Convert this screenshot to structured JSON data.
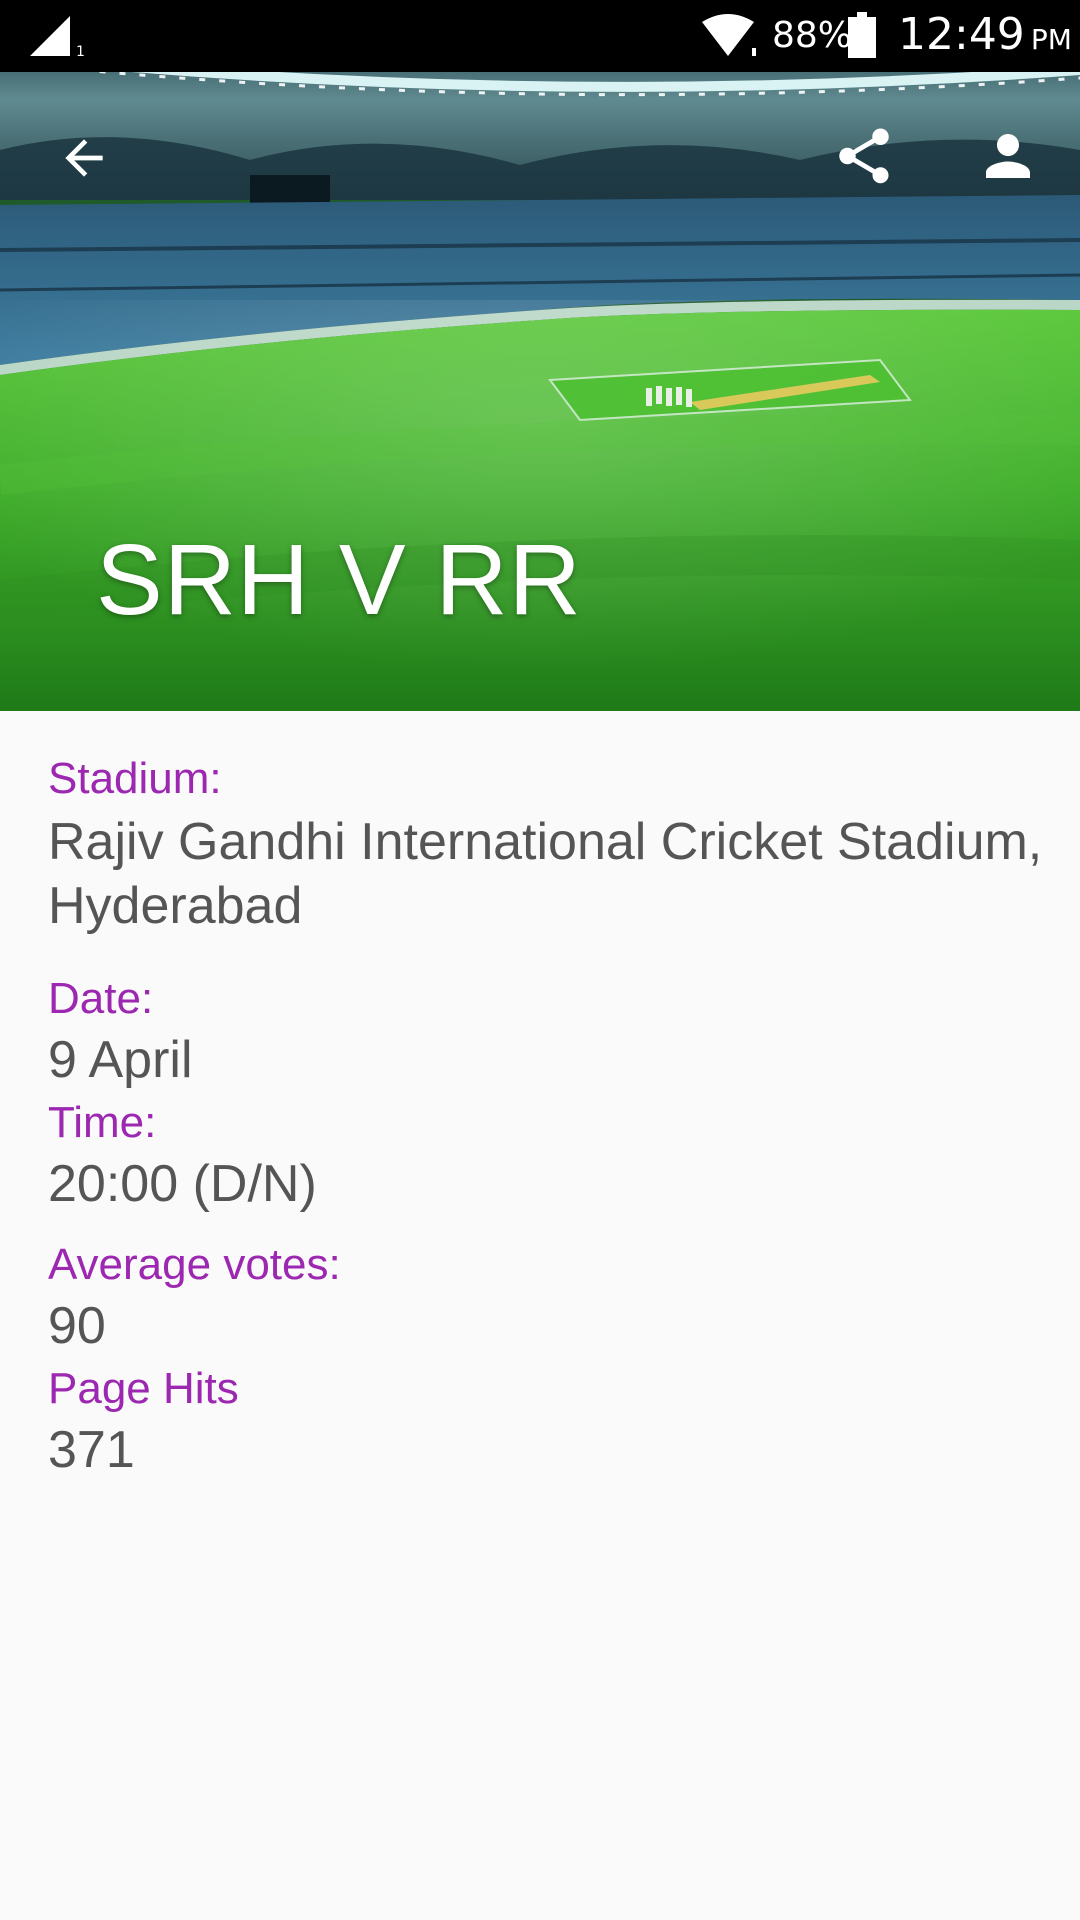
{
  "status_bar": {
    "signal_icon": "cell-signal-icon",
    "wifi_icon": "wifi-icon",
    "battery_percent": "88%",
    "battery_icon": "battery-icon",
    "time": "12:49",
    "ampm": "PM"
  },
  "toolbar": {
    "back_icon": "arrow-back-icon",
    "share_icon": "share-icon",
    "profile_icon": "person-icon"
  },
  "match": {
    "title": "SRH V RR"
  },
  "details": {
    "stadium_label": "Stadium:",
    "stadium_value": "Rajiv Gandhi International Cricket Stadium, Hyderabad",
    "date_label": "Date:",
    "date_value": "9 April",
    "time_label": "Time:",
    "time_value": "20:00 (D/N)",
    "avg_votes_label": "Average votes:",
    "avg_votes_value": "90",
    "page_hits_label": "Page Hits",
    "page_hits_value": "371"
  },
  "colors": {
    "label": "#9c27b0",
    "value": "#555555",
    "background": "#fafafa",
    "pitch_green": "#3fae2a"
  }
}
